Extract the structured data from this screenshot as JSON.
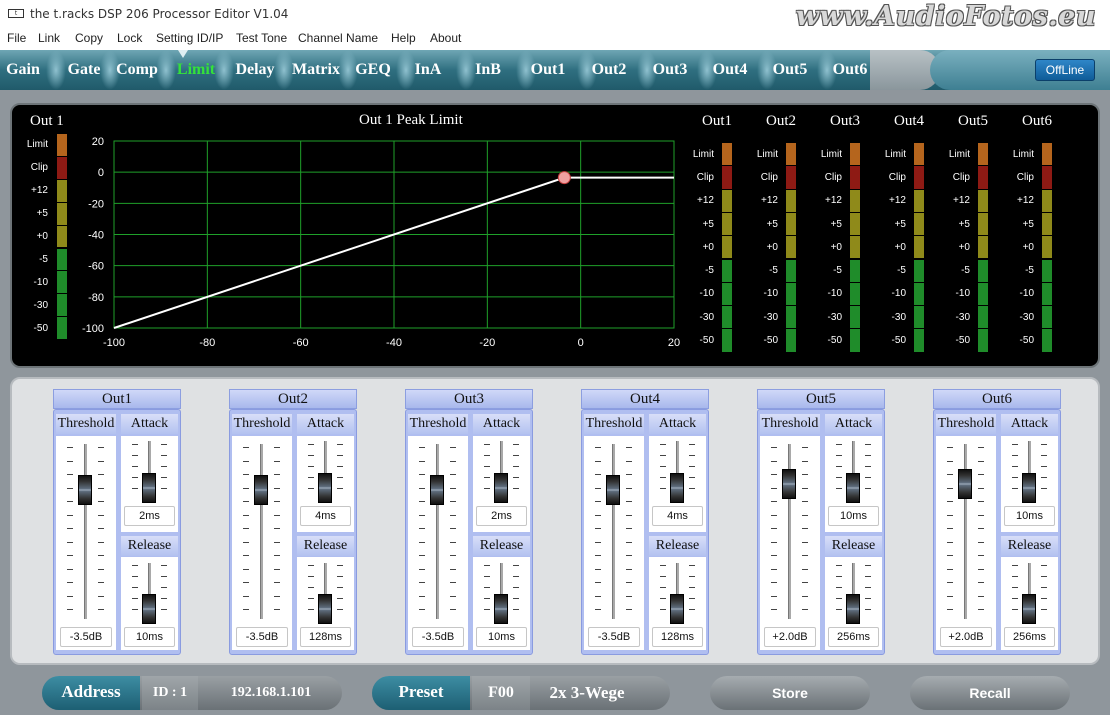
{
  "window": {
    "title": "the t.racks DSP 206 Processor Editor V1.04",
    "app_icon": "tracks-logo-icon",
    "watermark": "www.AudioFotos.eu"
  },
  "menu": [
    "File",
    "Link",
    "Copy",
    "Lock",
    "Setting ID/IP",
    "Test Tone",
    "Channel Name",
    "Help",
    "About"
  ],
  "tabs": [
    "Gain",
    "Gate",
    "Comp",
    "Limit",
    "Delay",
    "Matrix",
    "GEQ",
    "InA",
    "InB",
    "Out1",
    "Out2",
    "Out3",
    "Out4",
    "Out5",
    "Out6"
  ],
  "active_tab": "Limit",
  "active_color": "#34e23a",
  "status_button": "OffLine",
  "left_meter": {
    "title": "Out 1",
    "labels": [
      "Limit",
      "Clip",
      "+12",
      "+5",
      "+0",
      "-5",
      "-10",
      "-30",
      "-50"
    ],
    "colors": [
      "#b5651d",
      "#8e1a14",
      "#8f8a1a",
      "#8f8a1a",
      "#8f8a1a",
      "#1f8c2a",
      "#1f8c2a",
      "#1f8c2a",
      "#1f8c2a"
    ]
  },
  "graph": {
    "title": "Out 1  Peak Limit",
    "x_ticks": [
      "-100",
      "-80",
      "-60",
      "-40",
      "-20",
      "0",
      "20"
    ],
    "y_ticks": [
      "20",
      "0",
      "-20",
      "-40",
      "-60",
      "-80",
      "-100"
    ],
    "threshold": -3.5
  },
  "chart_data": {
    "type": "line",
    "title": "Out 1  Peak Limit",
    "xlabel": "",
    "ylabel": "",
    "xlim": [
      -100,
      20
    ],
    "ylim": [
      -100,
      20
    ],
    "series": [
      {
        "x": [
          -100,
          -3.5,
          20
        ],
        "y": [
          -100,
          -3.5,
          -3.5
        ]
      }
    ],
    "grid": true
  },
  "right_meters": {
    "channels": [
      "Out1",
      "Out2",
      "Out3",
      "Out4",
      "Out5",
      "Out6"
    ],
    "labels": [
      "Limit",
      "Clip",
      "+12",
      "+5",
      "+0",
      "-5",
      "-10",
      "-30",
      "-50"
    ],
    "colors": [
      "#b5651d",
      "#8e1a14",
      "#8f8a1a",
      "#8f8a1a",
      "#8f8a1a",
      "#1f8c2a",
      "#1f8c2a",
      "#1f8c2a",
      "#1f8c2a"
    ]
  },
  "channels": [
    {
      "name": "Out1",
      "threshold_label": "Threshold",
      "attack_label": "Attack",
      "release_label": "Release",
      "threshold": "-3.5dB",
      "attack": "2ms",
      "release": "10ms"
    },
    {
      "name": "Out2",
      "threshold_label": "Threshold",
      "attack_label": "Attack",
      "release_label": "Release",
      "threshold": "-3.5dB",
      "attack": "4ms",
      "release": "128ms"
    },
    {
      "name": "Out3",
      "threshold_label": "Threshold",
      "attack_label": "Attack",
      "release_label": "Release",
      "threshold": "-3.5dB",
      "attack": "2ms",
      "release": "10ms"
    },
    {
      "name": "Out4",
      "threshold_label": "Threshold",
      "attack_label": "Attack",
      "release_label": "Release",
      "threshold": "-3.5dB",
      "attack": "4ms",
      "release": "128ms"
    },
    {
      "name": "Out5",
      "threshold_label": "Threshold",
      "attack_label": "Attack",
      "release_label": "Release",
      "threshold": "+2.0dB",
      "attack": "10ms",
      "release": "256ms"
    },
    {
      "name": "Out6",
      "threshold_label": "Threshold",
      "attack_label": "Attack",
      "release_label": "Release",
      "threshold": "+2.0dB",
      "attack": "10ms",
      "release": "256ms"
    }
  ],
  "bottom": {
    "address_label": "Address",
    "id_label": "ID : 1",
    "ip": "192.168.1.101",
    "preset_label": "Preset",
    "preset_num": "F00",
    "preset_name": "2x 3-Wege",
    "store": "Store",
    "recall": "Recall"
  }
}
